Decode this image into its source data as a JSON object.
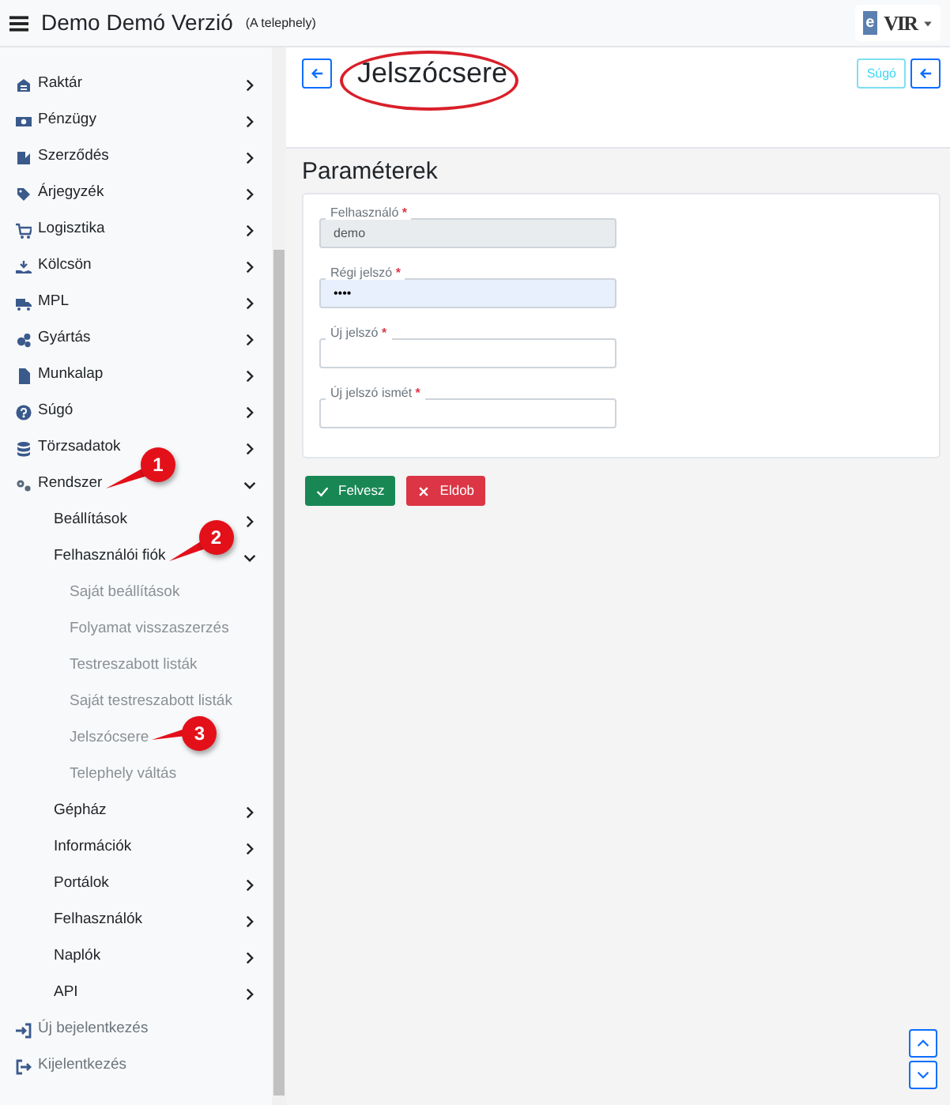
{
  "navbar": {
    "title": "Demo Demó Verzió",
    "subtitle": "(A telephely)",
    "brand": {
      "prefix": "e",
      "name": "VIR"
    }
  },
  "sidebar": {
    "items": [
      {
        "label": "Raktár",
        "expanded": false
      },
      {
        "label": "Pénzügy",
        "expanded": false
      },
      {
        "label": "Szerződés",
        "expanded": false
      },
      {
        "label": "Árjegyzék",
        "expanded": false
      },
      {
        "label": "Logisztika",
        "expanded": false
      },
      {
        "label": "Kölcsön",
        "expanded": false
      },
      {
        "label": "MPL",
        "expanded": false
      },
      {
        "label": "Gyártás",
        "expanded": false
      },
      {
        "label": "Munkalap",
        "expanded": false
      },
      {
        "label": "Súgó",
        "expanded": false
      },
      {
        "label": "Törzsadatok",
        "expanded": false
      },
      {
        "label": "Rendszer",
        "expanded": true,
        "callout": "1",
        "children": [
          {
            "label": "Beállítások",
            "expanded": false
          },
          {
            "label": "Felhasználói fiók",
            "expanded": true,
            "callout": "2",
            "children": [
              {
                "label": "Saját beállítások"
              },
              {
                "label": "Folyamat visszaszerzés"
              },
              {
                "label": "Testreszabott listák"
              },
              {
                "label": "Saját testreszabott listák"
              },
              {
                "label": "Jelszócsere",
                "callout": "3"
              },
              {
                "label": "Telephely váltás"
              }
            ]
          },
          {
            "label": "Gépház",
            "expanded": false
          },
          {
            "label": "Információk",
            "expanded": false
          },
          {
            "label": "Portálok",
            "expanded": false
          },
          {
            "label": "Felhasználók",
            "expanded": false
          },
          {
            "label": "Naplók",
            "expanded": false
          },
          {
            "label": "API",
            "expanded": false
          }
        ]
      }
    ],
    "footer_links": [
      {
        "label": "Új bejelentkezés"
      },
      {
        "label": "Kijelentkezés"
      }
    ]
  },
  "page": {
    "title": "Jelszócsere",
    "title_circled": true,
    "help_button": "Súgó"
  },
  "form": {
    "heading": "Paraméterek",
    "fields": [
      {
        "label": "Felhasználó",
        "required_mark": "*",
        "value": "demo",
        "disabled": true,
        "autofilled": false
      },
      {
        "label": "Régi jelszó",
        "required_mark": "*",
        "value": "••••",
        "disabled": false,
        "autofilled": true
      },
      {
        "label": "Új jelszó",
        "required_mark": "*",
        "disabled": false,
        "autofilled": false
      },
      {
        "label": "Új jelszó ismét",
        "required_mark": "*",
        "disabled": false,
        "autofilled": false
      }
    ],
    "buttons": [
      {
        "label": "Felvesz",
        "kind": "save"
      },
      {
        "label": "Eldob",
        "kind": "discard"
      }
    ]
  }
}
